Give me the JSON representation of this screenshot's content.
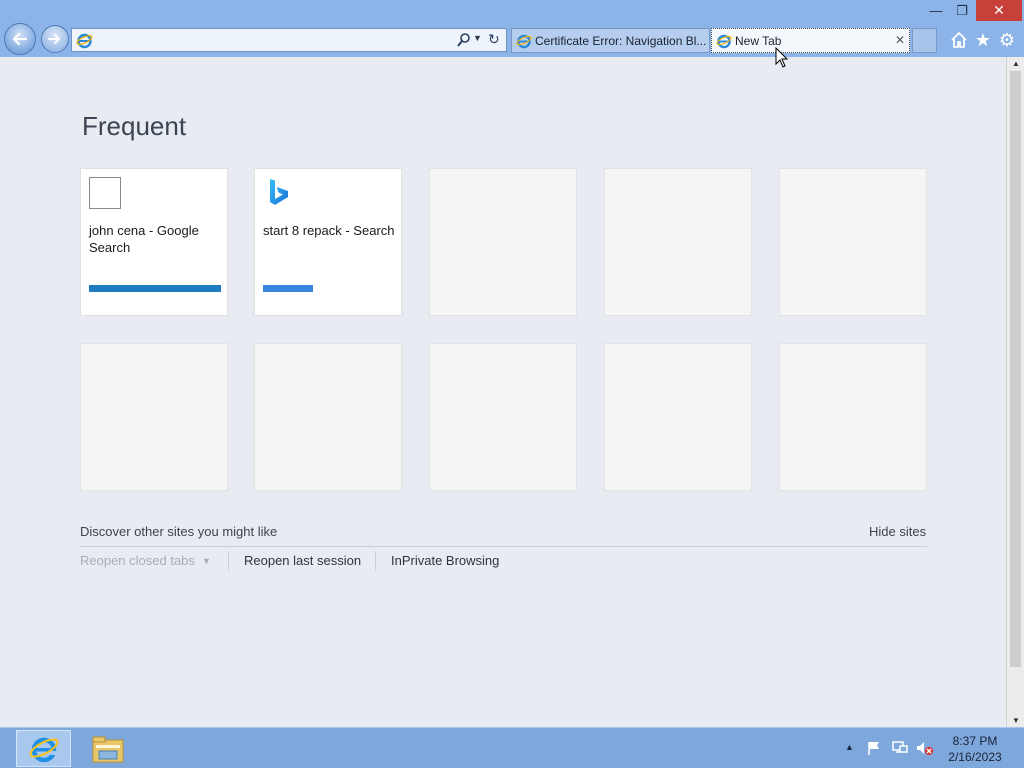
{
  "address_bar": {
    "value": "",
    "placeholder": ""
  },
  "tabs": [
    {
      "label": "Certificate Error: Navigation Bl...",
      "active": false
    },
    {
      "label": "New Tab",
      "active": true
    }
  ],
  "content": {
    "heading": "Frequent",
    "tiles": [
      {
        "title": "john cena - Google Search",
        "bar_color": "#1f7cc0",
        "bar_fraction": 1.0
      },
      {
        "title": "start 8 repack - Search",
        "bar_color": "#3a87e0",
        "bar_fraction": 0.38
      }
    ],
    "discover_text": "Discover other sites you might like",
    "hide_sites": "Hide sites",
    "reopen_closed_tabs": "Reopen closed tabs",
    "reopen_last_session": "Reopen last session",
    "inprivate_browsing": "InPrivate Browsing"
  },
  "taskbar": {
    "clock_time": "8:37 PM",
    "clock_date": "2/16/2023"
  },
  "icons": {
    "back": "back-arrow-icon",
    "forward": "forward-arrow-icon",
    "home": "home-icon",
    "favorites": "star-icon",
    "tools": "gear-icon"
  }
}
